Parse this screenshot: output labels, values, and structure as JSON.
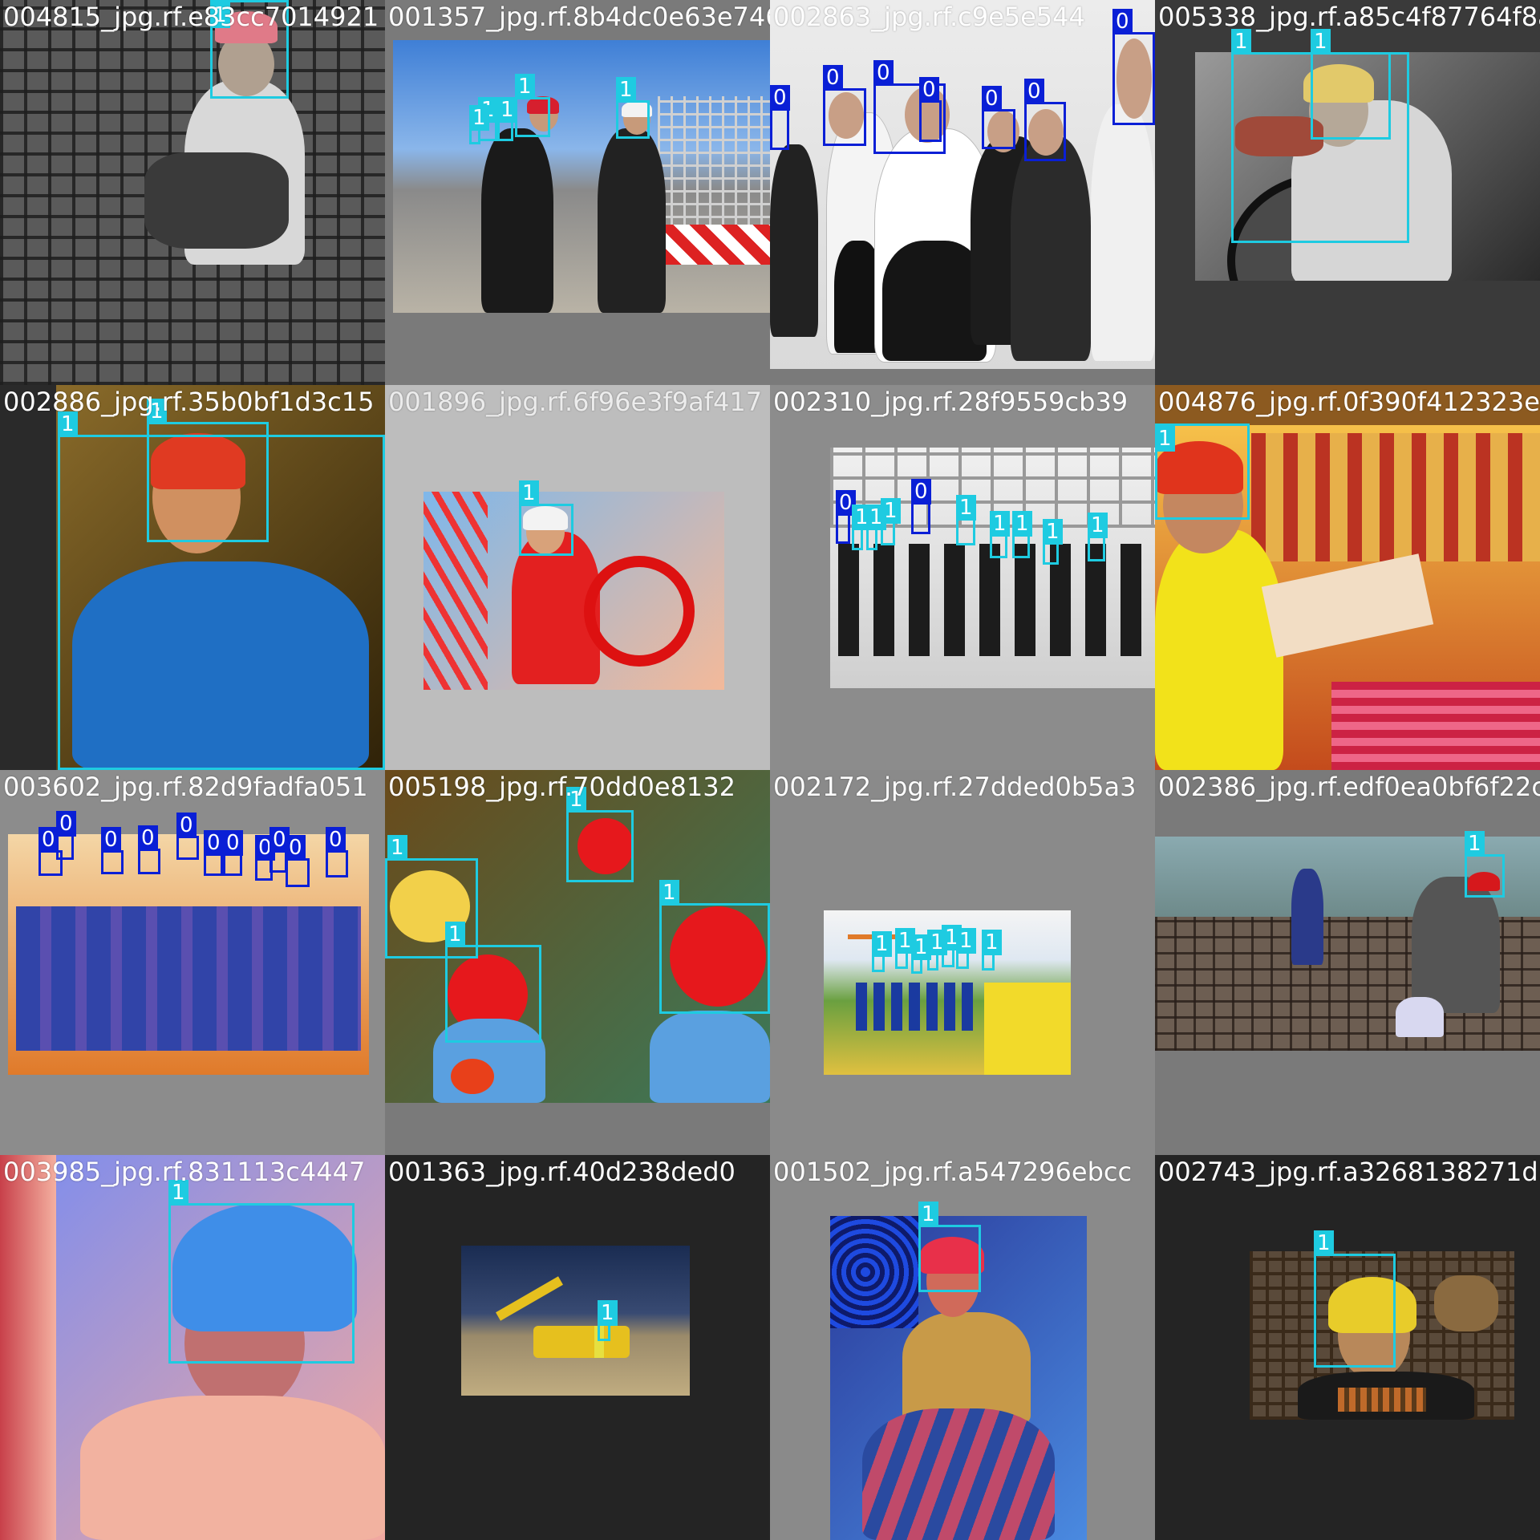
{
  "mosaic": {
    "tiles": [
      {
        "file": "004815_jpg.rf.e83cc7014921"
      },
      {
        "file": "001357_jpg.rf.8b4dc0e63e746"
      },
      {
        "file": "002863_jpg.rf.c9e5e544"
      },
      {
        "file": "005338_jpg.rf.a85c4f87764f8a79fa"
      },
      {
        "file": "002886_jpg.rf.35b0bf1d3c15"
      },
      {
        "file": "001896_jpg.rf.6f96e3f9af417"
      },
      {
        "file": "002310_jpg.rf.28f9559cb39"
      },
      {
        "file": "004876_jpg.rf.0f390f412323ee3"
      },
      {
        "file": "003602_jpg.rf.82d9fadfa051"
      },
      {
        "file": "005198_jpg.rf.70dd0e8132"
      },
      {
        "file": "002172_jpg.rf.27dded0b5a3"
      },
      {
        "file": "002386_jpg.rf.edf0ea0bf6f22c6c"
      },
      {
        "file": "003985_jpg.rf.831113c4447"
      },
      {
        "file": "001363_jpg.rf.40d238ded0"
      },
      {
        "file": "001502_jpg.rf.a547296ebcc"
      },
      {
        "file": "002743_jpg.rf.a3268138271d5"
      }
    ]
  },
  "class_labels": {
    "helmet": "1",
    "head": "0"
  },
  "colors": {
    "class_1_box": "#1ecbe1",
    "class_0_box": "#0a1fd6"
  }
}
